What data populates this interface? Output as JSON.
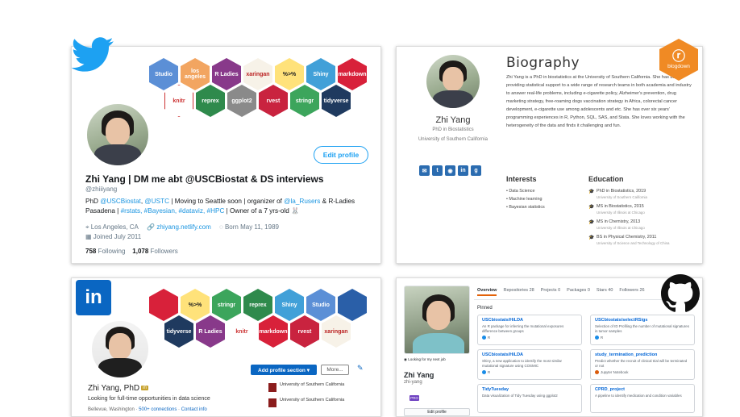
{
  "colors": {
    "twitter": "#1da1f2",
    "linkedin": "#0a66c2",
    "blogdown": "#f08a24",
    "github": "#24292e",
    "link": "#1b95e0"
  },
  "hex_stickers_top": [
    {
      "label": "Studio",
      "color": "#5b8fd6"
    },
    {
      "label": "los angeles",
      "color": "#f2a561"
    },
    {
      "label": "R Ladies",
      "color": "#88398a"
    },
    {
      "label": "xaringan",
      "color": "#f7f2e8"
    },
    {
      "label": "%>%",
      "color": "#ffe27a"
    },
    {
      "label": "Shiny",
      "color": "#41a0d8"
    },
    {
      "label": "markdown",
      "color": "#d8213a"
    },
    {
      "label": "knitr",
      "color": "#ffffff"
    },
    {
      "label": "reprex",
      "color": "#2f8a4c"
    },
    {
      "label": "ggplot2",
      "color": "#8a8a8a"
    },
    {
      "label": "rvest",
      "color": "#c9233f"
    },
    {
      "label": "stringr",
      "color": "#3ca55c"
    },
    {
      "label": "tidyverse",
      "color": "#1f3a5f"
    }
  ],
  "twitter": {
    "icon": "twitter-bird-icon",
    "name": "Zhi Yang | DM me abt @USCBiostat & DS interviews",
    "handle": "@zhiiiyang",
    "bio_part1": "PhD ",
    "bio_link1": "@USCBiostat",
    "bio_part2": ", ",
    "bio_link2": "@USTC",
    "bio_part3": " | Moving to Seattle soon | organizer of ",
    "bio_link3": "@la_Rusers",
    "bio_part4": " & R-Ladies Pasadena | ",
    "bio_tags": "#rstats, #Bayesian, #dataviz, #HPC",
    "bio_part5": " | Owner of a 7 yrs-old 🐰",
    "location": "Los Angeles, CA",
    "website": "zhiyang.netlify.com",
    "born": "Born May 11, 1989",
    "joined": "Joined July 2011",
    "following_count": "758",
    "following_label": "Following",
    "followers_count": "1,078",
    "followers_label": "Followers",
    "edit_profile": "Edit profile"
  },
  "blogdown": {
    "logo_text": "blogdown",
    "name": "Zhi Yang",
    "title": "PhD in Biostatistics",
    "affiliation": "University of Southern California",
    "heading": "Biography",
    "bio": "Zhi Yang is a PhD in biostatistics at the University of Southern California. She has been providing statistical support to a wide range of research teams in both academia and industry to answer real-life problems, including e-cigarette policy, Alzheimer's prevention, drug marketing strategy, free-roaming dogs vaccination strategy in Africa, colorectal cancer development, e-cigarette use among adolescents and etc. She has over six years' programming experiences in R, Python, SQL, SAS, and Stata. She loves working with the heterogeneity of the data and finds it challenging and fun.",
    "interests_heading": "Interests",
    "interests": [
      "Data Science",
      "Machine learning",
      "Bayesian statistics"
    ],
    "education_heading": "Education",
    "education": [
      {
        "degree": "PhD in Biostatistics, 2019",
        "inst": "University of Southern California"
      },
      {
        "degree": "MS in Biostatistics, 2015",
        "inst": "University of Illinois at Chicago"
      },
      {
        "degree": "MS in Chemistry, 2013",
        "inst": "University of Illinois at Chicago"
      },
      {
        "degree": "BS in Physical Chemistry, 2011",
        "inst": "University of Science and Technology of China"
      }
    ]
  },
  "linkedin": {
    "logo_text": "in",
    "name": "Zhi Yang, PhD",
    "badge": "in",
    "tagline": "Looking for full-time opportunities in data science",
    "location": "Bellevue, Washington",
    "connections": "500+ connections",
    "contact": "Contact info",
    "add_section": "Add profile section ▾",
    "more": "More...",
    "schools": [
      "University of Southern California",
      "University of Southern California"
    ]
  },
  "github": {
    "tabs": [
      "Overview",
      "Repositories 28",
      "Projects 0",
      "Packages 0",
      "Stars 40",
      "Followers 26"
    ],
    "pinned_label": "Pinned",
    "looking": "Looking for my next job",
    "name": "Zhi Yang",
    "login": "zhi-yang",
    "pro": "PRO",
    "edit_profile": "Edit profile",
    "pins": [
      {
        "title": "USCbiostats/HiLDA",
        "desc": "An R package for inferring the mutational exposures difference between groups",
        "lang": "R",
        "lang_color": "#198ce7"
      },
      {
        "title": "USCbiostats/selectRSigs",
        "desc": "Selection of ID Profiling the number of mutational signatures in tumor samples",
        "lang": "R",
        "lang_color": "#198ce7"
      },
      {
        "title": "USCbiostats/HiLDA",
        "desc": "Shiny, a new application to identify the most similar mutational signature using COSMIC",
        "lang": "R",
        "lang_color": "#198ce7"
      },
      {
        "title": "study_termination_prediction",
        "desc": "Predict whether the recruit of clinical trial will be terminated or not",
        "lang": "Jupyter Notebook",
        "lang_color": "#da5b0b"
      },
      {
        "title": "TidyTuesday",
        "desc": "Data visualization of Tidy Tuesday using ggplot2",
        "lang": "R",
        "lang_color": "#198ce7"
      },
      {
        "title": "CPRD_project",
        "desc": "A pipeline to identify medication and condition variables",
        "lang": "R",
        "lang_color": "#198ce7"
      }
    ]
  }
}
